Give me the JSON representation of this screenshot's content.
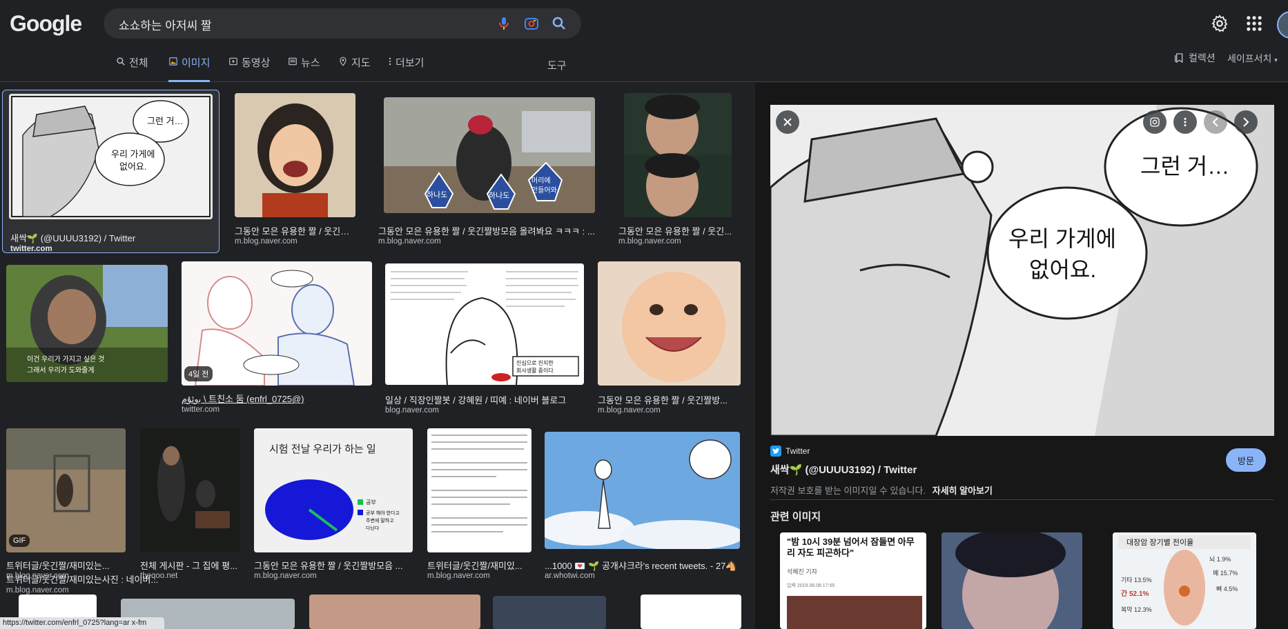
{
  "header": {
    "logo": "Google",
    "search_value": "쇼쇼하는 아저씨 짤",
    "tabs": [
      {
        "label": "전체",
        "icon": "search-icon"
      },
      {
        "label": "이미지",
        "icon": "image-icon",
        "active": true
      },
      {
        "label": "동영상",
        "icon": "play-icon"
      },
      {
        "label": "뉴스",
        "icon": "news-icon"
      },
      {
        "label": "지도",
        "icon": "map-pin-icon"
      },
      {
        "label": "더보기",
        "icon": "more-vertical-icon"
      }
    ],
    "tools": "도구",
    "collections": "컬렉션",
    "safesearch": "세이프서치"
  },
  "results": [
    {
      "title": "새싹🌱 (@UUUU3192) / Twitter",
      "source": "twitter.com",
      "selected": true
    },
    {
      "title": "그동안 모은 유용한 짤 / 웃긴짤방...",
      "source": "m.blog.naver.com"
    },
    {
      "title": "그동안 모은 유용한 짤 / 웃긴짤방모음 올려봐요 ㅋㅋㅋ : ...",
      "source": "m.blog.naver.com"
    },
    {
      "title": "그동안 모은 유용한 짤 / 웃긴...",
      "source": "m.blog.naver.com"
    },
    {
      "title": "트위터글/웃긴짤/재미있는사진 : 네이버...",
      "source": "m.blog.naver.com"
    },
    {
      "title": "ﺑﻭﺋﯘﻡ \\ 트친소 둠 (enfrl_0725@)",
      "source": "twitter.com",
      "badge": "4일 전"
    },
    {
      "title": "일상 / 직장인짤봇 / 강혜원 / 띠예 : 네이버 블로그",
      "source": "blog.naver.com"
    },
    {
      "title": "그동안 모은 유용한 짤 / 웃긴짤방...",
      "source": "m.blog.naver.com"
    },
    {
      "title": "트위터글/웃긴짤/재미있는...",
      "source": "m.blog.naver.com",
      "badge": "GIF"
    },
    {
      "title": "전체 게시판 - 그 집에 평...",
      "source": "theqoo.net"
    },
    {
      "title": "그동안 모은 유용한 짤 / 웃긴짤방모음 ...",
      "source": "m.blog.naver.com"
    },
    {
      "title": "트위터글/웃긴짤/재미있...",
      "source": "m.blog.naver.com"
    },
    {
      "title": "...1000 💌 🌱 공개샤크라's recent tweets. - 27🐴",
      "source": "ar.whotwi.com"
    }
  ],
  "image_text": {
    "r1_speech1": "그런 거…",
    "r1_speech2": "우리 가게에 없어요.",
    "r3_label1": "하나도",
    "r3_label2": "하나도",
    "r3_label3": "머리에 안 들어와",
    "r11_title": "시험 전날 우리가 하는 일",
    "r11_legend1": "공부",
    "r11_legend2": "공부 해야 한다고 주변에 말하고 다닌다",
    "r12_text": "저스와 'eve Sleep' 연구진은 영국 사람 2,000명에게 취침하는 시간, 수면 시간, 피로감, 스트레스 등을 조사해 '적정 수면 시간'을 도출해냈다. 해당 연구로 도출된 최상의 적정 수면 시간은 바로 '밤 10시 39분'이었다.",
    "r7_box": "진심으로 진지한 회사생활 중이다"
  },
  "panel": {
    "source_name": "Twitter",
    "title": "새싹🌱 (@UUUU3192) / Twitter",
    "visit": "방문",
    "copyright": "저작권 보호를 받는 이미지일 수 있습니다.",
    "learn_more": "자세히 알아보기",
    "related_title": "관련 이미지",
    "preview_speech1": "그런 거…",
    "preview_speech2a": "우리 가게에",
    "preview_speech2b": "없어요.",
    "related": [
      {
        "headline": "\"밤 10시 39분 넘어서 잠들면 아무리 자도 피곤하다\"",
        "byline": "석혜진 기자",
        "date": "입력 2019.08.08 17:55"
      },
      {
        "headline": ""
      },
      {
        "headline": "대장암 장기별 전이율",
        "stat1": "뇌 1.9%",
        "stat2": "기타 13.5%",
        "stat3": "폐 15.7%",
        "stat4": "간 52.1%",
        "stat5": "뼈 4.5%",
        "stat6": "복막 12.3%"
      }
    ]
  },
  "status_url": "https://twitter.com/enfrl_0725?lang=ar x-fm",
  "colors": {
    "accent": "#8ab4f8",
    "bg": "#202124",
    "panel_bg": "#171717"
  }
}
